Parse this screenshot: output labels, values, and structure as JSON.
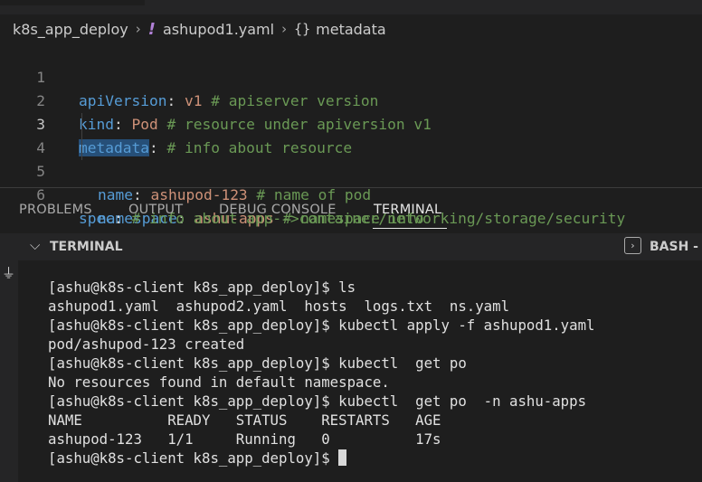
{
  "breadcrumb": {
    "folder": "k8s_app_deploy",
    "file_icon": "!",
    "file": "ashupod1.yaml",
    "symbol_icon": "{}",
    "symbol": "metadata"
  },
  "editor": {
    "lines": [
      {
        "num": "1",
        "key": "apiVersion",
        "colon": ":",
        "value": " v1",
        "comment": " # apiserver version"
      },
      {
        "num": "2",
        "key": "kind",
        "colon": ":",
        "value": " Pod",
        "comment": " # resource under apiversion v1"
      },
      {
        "num": "3",
        "key": "metadata",
        "colon": ":",
        "value": "",
        "comment": " # info about resource"
      },
      {
        "num": "4",
        "key": "name",
        "colon": ":",
        "value": " ashupod-123",
        "comment": " # name of pod"
      },
      {
        "num": "5",
        "key": "namespace",
        "colon": ":",
        "value": " ashu-apps",
        "comment": " # namespace info"
      },
      {
        "num": "6",
        "key": "spec",
        "colon": ":",
        "value": "",
        "comment": " # info about app-->container/networking/storage/security"
      }
    ],
    "active_line": "3"
  },
  "panel": {
    "tabs": [
      "PROBLEMS",
      "OUTPUT",
      "DEBUG CONSOLE",
      "TERMINAL"
    ],
    "active_tab": "TERMINAL",
    "header_title": "TERMINAL",
    "shell_label": "BASH -"
  },
  "terminal": {
    "lines": [
      "[ashu@k8s-client k8s_app_deploy]$ ls",
      "ashupod1.yaml  ashupod2.yaml  hosts  logs.txt  ns.yaml",
      "[ashu@k8s-client k8s_app_deploy]$ kubectl apply -f ashupod1.yaml",
      "pod/ashupod-123 created",
      "[ashu@k8s-client k8s_app_deploy]$ kubectl  get po",
      "No resources found in default namespace.",
      "[ashu@k8s-client k8s_app_deploy]$ kubectl  get po  -n ashu-apps",
      "NAME          READY   STATUS    RESTARTS   AGE",
      "ashupod-123   1/1     Running   0          17s"
    ],
    "prompt": "[ashu@k8s-client k8s_app_deploy]$ "
  },
  "icons": {
    "breadcrumb_chevron": "chevron-right-icon",
    "yaml_file": "yaml-exclamation-icon",
    "symbol": "braces-icon",
    "terminal_collapse": "chevron-down-icon",
    "terminal_kind": "terminal-bash-icon",
    "activity_chevron": "chevron-right-icon",
    "activity_plug": "plug-icon"
  },
  "colors": {
    "background": "#1e1e1e",
    "key": "#569cd6",
    "value": "#ce9178",
    "comment": "#6a9955",
    "selection": "#264f78",
    "yaml_icon": "#b180d7"
  }
}
